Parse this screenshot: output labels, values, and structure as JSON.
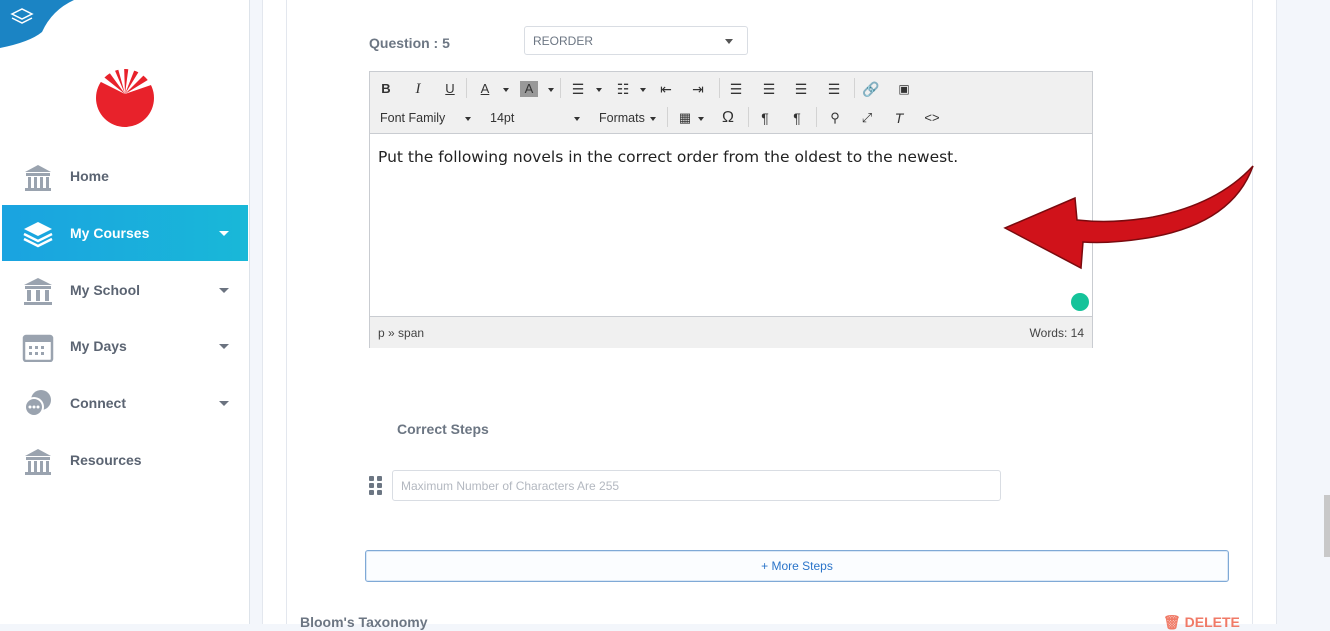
{
  "sidebar": {
    "items": [
      {
        "label": "Home",
        "icon": "school-building-icon",
        "has_caret": false
      },
      {
        "label": "My Courses",
        "icon": "stacked-layers-icon",
        "has_caret": true,
        "active": true
      },
      {
        "label": "My School",
        "icon": "columns-building-icon",
        "has_caret": true
      },
      {
        "label": "My Days",
        "icon": "calendar-icon",
        "has_caret": true
      },
      {
        "label": "Connect",
        "icon": "chat-bubbles-icon",
        "has_caret": true
      },
      {
        "label": "Resources",
        "icon": "school-building-icon",
        "has_caret": false
      }
    ]
  },
  "question": {
    "label": "Question : 5",
    "type_value": "REORDER"
  },
  "editor": {
    "font_family_label": "Font Family",
    "font_size_label": "14pt",
    "formats_label": "Formats",
    "content": "Put the following novels in the correct order from the oldest to the newest.",
    "path": "p » span",
    "words": "Words: 14"
  },
  "steps": {
    "heading": "Correct Steps",
    "input_placeholder": "Maximum Number of Characters Are 255",
    "more_button": "+ More Steps"
  },
  "bloom": {
    "heading": "Bloom's Taxonomy",
    "delete_label": "DELETE"
  },
  "colors": {
    "accent": "#1aa3e0",
    "brand": "#e8222b",
    "delete": "#f07a67",
    "arrow": "#d0121a"
  }
}
